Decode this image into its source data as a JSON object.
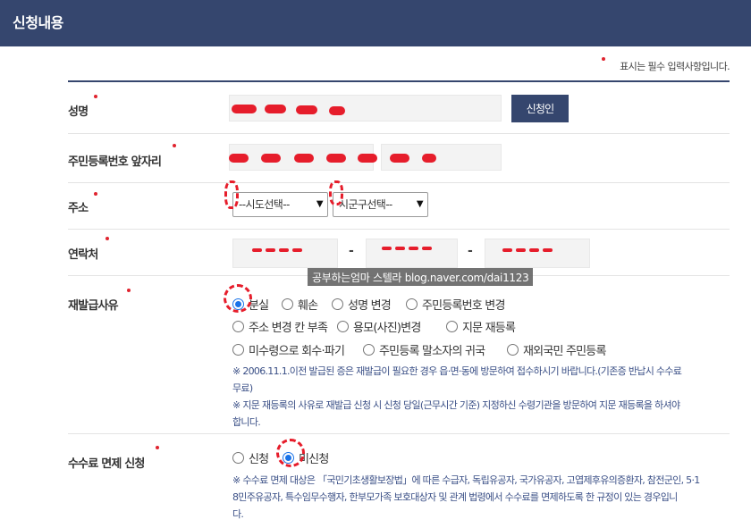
{
  "header": {
    "title": "신청내용"
  },
  "required_note": "표시는 필수 입력사항입니다.",
  "form": {
    "name_label": "성명",
    "apply_button": "신청인",
    "rrn_label": "주민등록번호 앞자리",
    "address_label": "주소",
    "sido_select": "--시도선택--",
    "sigungu_select": "시군구선택--",
    "contact_label": "연락처",
    "contact_dash": "-",
    "reason_label": "재발급사유",
    "reasons": [
      {
        "label": "분실",
        "selected": true
      },
      {
        "label": "훼손",
        "selected": false
      },
      {
        "label": "성명 변경",
        "selected": false
      },
      {
        "label": "주민등록번호 변경",
        "selected": false
      },
      {
        "label": "주소 변경 칸 부족",
        "selected": false
      },
      {
        "label": "용모(사진)변경",
        "selected": false
      },
      {
        "label": "지문 재등록",
        "selected": false
      },
      {
        "label": "미수령으로 회수·파기",
        "selected": false
      },
      {
        "label": "주민등록 말소자의 귀국",
        "selected": false
      },
      {
        "label": "재외국민 주민등록",
        "selected": false
      }
    ],
    "reason_note_1a": "※ 2006.11.1.이전 발급된 증은 재발급이 필요한 경우 읍·면·동에 방문하여 접수하시기 바랍니다.(기존증 반납시 수수료",
    "reason_note_1b": "무료)",
    "reason_note_2a": "※ 지문 재등록의 사유로 재발급 신청 시 신청 당일(근무시간 기준) 지정하신 수령기관을 방문하여 지문 재등록을 하셔야",
    "reason_note_2b": "합니다.",
    "fee_label": "수수료 면제 신청",
    "fee_options": [
      {
        "label": "신청",
        "selected": false
      },
      {
        "label": "미신청",
        "selected": true
      }
    ],
    "fee_note_a": "※ 수수료 면제 대상은 「국민기초생활보장법」에 따른 수급자, 독립유공자, 국가유공자, 고엽제후유의증환자, 참전군인, 5·1",
    "fee_note_b": "8민주유공자, 특수임무수행자, 한부모가족 보호대상자 및 관계 법령에서 수수료를 면제하도록 한 규정이 있는 경우입니",
    "fee_note_c": "다."
  },
  "watermark": "공부하는엄마 스텔라 blog.naver.com/dai1123",
  "colors": {
    "header_bg": "#35466e",
    "required_dot": "#e0242f",
    "note_text": "#3a4f86",
    "radio_selected": "#1a73e8"
  }
}
